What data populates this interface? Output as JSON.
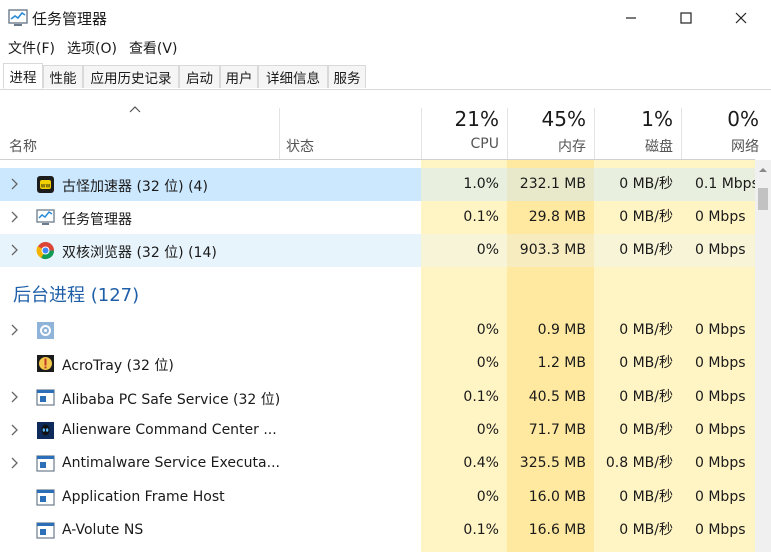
{
  "window": {
    "title": "任务管理器",
    "icon": "task-manager-icon"
  },
  "menu": [
    "文件(F)",
    "选项(O)",
    "查看(V)"
  ],
  "tabs": [
    "进程",
    "性能",
    "应用历史记录",
    "启动",
    "用户",
    "详细信息",
    "服务"
  ],
  "active_tab": "进程",
  "columns": {
    "name": "名称",
    "status": "状态",
    "cpu": {
      "label": "CPU",
      "pct": "21%"
    },
    "memory": {
      "label": "内存",
      "pct": "45%"
    },
    "disk": {
      "label": "磁盘",
      "pct": "1%"
    },
    "network": {
      "label": "网络",
      "pct": "0%"
    }
  },
  "apps": [
    {
      "name": "古怪加速器 (32 位) (4)",
      "icon": "accelerator-app-icon",
      "expandable": true,
      "cpu": "1.0%",
      "mem": "232.1 MB",
      "disk": "0 MB/秒",
      "net": "0.1 Mbps"
    },
    {
      "name": "任务管理器",
      "icon": "task-manager-icon",
      "expandable": true,
      "cpu": "0.1%",
      "mem": "29.8 MB",
      "disk": "0 MB/秒",
      "net": "0 Mbps"
    },
    {
      "name": "双核浏览器 (32 位) (14)",
      "icon": "browser-icon",
      "expandable": true,
      "cpu": "0%",
      "mem": "903.3 MB",
      "disk": "0 MB/秒",
      "net": "0 Mbps"
    }
  ],
  "background_section": "后台进程 (127)",
  "background": [
    {
      "name": "",
      "icon": "gear-icon",
      "expandable": true,
      "cpu": "0%",
      "mem": "0.9 MB",
      "disk": "0 MB/秒",
      "net": "0 Mbps"
    },
    {
      "name": "AcroTray (32 位)",
      "icon": "acrotray-icon",
      "expandable": false,
      "cpu": "0%",
      "mem": "1.2 MB",
      "disk": "0 MB/秒",
      "net": "0 Mbps"
    },
    {
      "name": "Alibaba PC Safe Service (32 位)",
      "icon": "service-window-icon",
      "expandable": true,
      "cpu": "0.1%",
      "mem": "40.5 MB",
      "disk": "0 MB/秒",
      "net": "0 Mbps"
    },
    {
      "name": "Alienware Command Center ...",
      "icon": "alienware-icon",
      "expandable": true,
      "cpu": "0%",
      "mem": "71.7 MB",
      "disk": "0 MB/秒",
      "net": "0 Mbps"
    },
    {
      "name": "Antimalware Service Executa...",
      "icon": "service-window-icon",
      "expandable": true,
      "cpu": "0.4%",
      "mem": "325.5 MB",
      "disk": "0.8 MB/秒",
      "net": "0 Mbps"
    },
    {
      "name": "Application Frame Host",
      "icon": "service-window-icon",
      "expandable": false,
      "cpu": "0%",
      "mem": "16.0 MB",
      "disk": "0 MB/秒",
      "net": "0 Mbps"
    },
    {
      "name": "A-Volute NS",
      "icon": "service-window-icon",
      "expandable": false,
      "cpu": "0.1%",
      "mem": "16.6 MB",
      "disk": "0 MB/秒",
      "net": "0 Mbps"
    }
  ],
  "colors": {
    "heat_low": "#fff4c4",
    "heat_mid": "#ffe9a0",
    "selected": "#cce8ff",
    "section": "#1f5fa8"
  }
}
